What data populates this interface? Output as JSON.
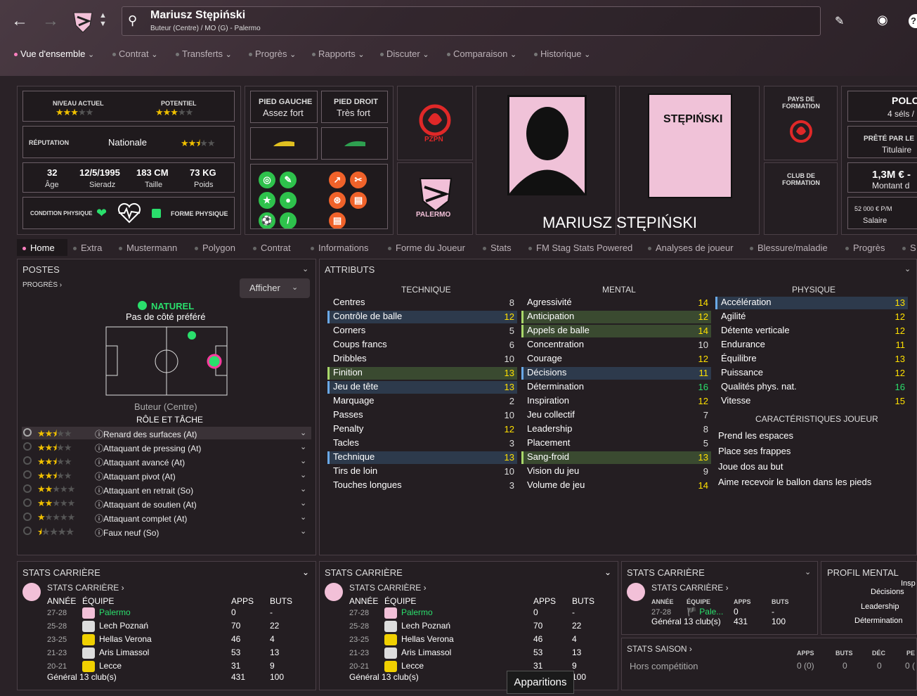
{
  "header": {
    "name": "Mariusz Stępiński",
    "subtitle": "Buteur (Centre) / MO (G) - Palermo"
  },
  "menu": [
    {
      "label": "Vue d'ensemble"
    },
    {
      "label": "Contrat"
    },
    {
      "label": "Transferts"
    },
    {
      "label": "Progrès"
    },
    {
      "label": "Rapports"
    },
    {
      "label": "Discuter"
    },
    {
      "label": "Comparaison"
    },
    {
      "label": "Historique"
    }
  ],
  "info": {
    "niveau_label": "NIVEAU ACTUEL",
    "potentiel_label": "POTENTIEL",
    "niveau_stars": 3,
    "potentiel_stars": 3,
    "reputation_label": "RÉPUTATION",
    "reputation_value": "Nationale",
    "reputation_stars": 2.5,
    "age": "32",
    "age_label": "Âge",
    "dob": "12/5/1995",
    "birthplace": "Sieradz",
    "height": "183 CM",
    "height_label": "Taille",
    "weight": "73 KG",
    "weight_label": "Poids",
    "condition_label": "CONDITION PHYSIQUE",
    "forme_label": "FORME PHYSIQUE"
  },
  "feet": {
    "left_label": "PIED GAUCHE",
    "left_value": "Assez fort",
    "right_label": "PIED DROIT",
    "right_value": "Très fort"
  },
  "badges": {
    "pzpn": "PZPN",
    "palermo": "PALERMO"
  },
  "player": {
    "full_name": "MARIUSZ STĘPIŃSKI",
    "shirt_name": "STĘPIŃSKI"
  },
  "formation": {
    "pays_label": "PAYS DE FORMATION",
    "club_label": "CLUB DE FORMATION"
  },
  "right_cards": {
    "pologne": "POLO",
    "sels": "4 séls /",
    "prete_label": "PRÊTÉ PAR LE",
    "titulaire": "Titulaire",
    "montant": "1,3M € -",
    "montant_label": "Montant d",
    "salaire": "52 000 € P/M",
    "salaire_label": "Salaire"
  },
  "tabs": [
    {
      "label": "Home"
    },
    {
      "label": "Extra"
    },
    {
      "label": "Mustermann"
    },
    {
      "label": "Polygon"
    },
    {
      "label": "Contrat"
    },
    {
      "label": "Informations"
    },
    {
      "label": "Forme du Joueur"
    },
    {
      "label": "Stats"
    },
    {
      "label": "FM Stag Stats Powered"
    },
    {
      "label": "Analyses de joueur"
    },
    {
      "label": "Blessure/maladie"
    },
    {
      "label": "Progrès"
    },
    {
      "label": "S"
    }
  ],
  "postes": {
    "title": "POSTES",
    "progres": "PROGRÈS",
    "afficher": "Afficher",
    "naturel": "NATUREL",
    "cote": "Pas de côté préféré",
    "position": "Buteur (Centre)",
    "role_title": "RÔLE ET TÂCHE",
    "roles": [
      {
        "label": "Renard des surfaces (At)",
        "stars": 2.5
      },
      {
        "label": "Attaquant de pressing (At)",
        "stars": 2.5
      },
      {
        "label": "Attaquant avancé (At)",
        "stars": 2.5
      },
      {
        "label": "Attaquant pivot (At)",
        "stars": 2.5
      },
      {
        "label": "Attaquant en retrait (So)",
        "stars": 2
      },
      {
        "label": "Attaquant de soutien (At)",
        "stars": 2
      },
      {
        "label": "Attaquant complet (At)",
        "stars": 1
      },
      {
        "label": "Faux neuf (So)",
        "stars": 0.5
      }
    ]
  },
  "attributes": {
    "title": "ATTRIBUTS",
    "technique_title": "TECHNIQUE",
    "mental_title": "MENTAL",
    "physique_title": "PHYSIQUE",
    "technique": [
      {
        "name": "Centres",
        "v": "8",
        "c": "w",
        "h": ""
      },
      {
        "name": "Contrôle de balle",
        "v": "12",
        "c": "y",
        "h": "blue"
      },
      {
        "name": "Corners",
        "v": "5",
        "c": "w",
        "h": ""
      },
      {
        "name": "Coups francs",
        "v": "6",
        "c": "w",
        "h": ""
      },
      {
        "name": "Dribbles",
        "v": "10",
        "c": "w",
        "h": ""
      },
      {
        "name": "Finition",
        "v": "13",
        "c": "y",
        "h": "green"
      },
      {
        "name": "Jeu de tête",
        "v": "13",
        "c": "y",
        "h": "blue"
      },
      {
        "name": "Marquage",
        "v": "2",
        "c": "w",
        "h": ""
      },
      {
        "name": "Passes",
        "v": "10",
        "c": "w",
        "h": ""
      },
      {
        "name": "Penalty",
        "v": "12",
        "c": "y",
        "h": ""
      },
      {
        "name": "Tacles",
        "v": "3",
        "c": "w",
        "h": ""
      },
      {
        "name": "Technique",
        "v": "13",
        "c": "y",
        "h": "blue"
      },
      {
        "name": "Tirs de loin",
        "v": "10",
        "c": "w",
        "h": ""
      },
      {
        "name": "Touches longues",
        "v": "3",
        "c": "w",
        "h": ""
      }
    ],
    "mental": [
      {
        "name": "Agressivité",
        "v": "14",
        "c": "y",
        "h": ""
      },
      {
        "name": "Anticipation",
        "v": "12",
        "c": "y",
        "h": "green"
      },
      {
        "name": "Appels de balle",
        "v": "14",
        "c": "y",
        "h": "green"
      },
      {
        "name": "Concentration",
        "v": "10",
        "c": "w",
        "h": ""
      },
      {
        "name": "Courage",
        "v": "12",
        "c": "y",
        "h": ""
      },
      {
        "name": "Décisions",
        "v": "11",
        "c": "y",
        "h": "blue"
      },
      {
        "name": "Détermination",
        "v": "16",
        "c": "g",
        "h": ""
      },
      {
        "name": "Inspiration",
        "v": "12",
        "c": "y",
        "h": ""
      },
      {
        "name": "Jeu collectif",
        "v": "7",
        "c": "w",
        "h": ""
      },
      {
        "name": "Leadership",
        "v": "8",
        "c": "w",
        "h": ""
      },
      {
        "name": "Placement",
        "v": "5",
        "c": "w",
        "h": ""
      },
      {
        "name": "Sang-froid",
        "v": "13",
        "c": "y",
        "h": "green"
      },
      {
        "name": "Vision du jeu",
        "v": "9",
        "c": "w",
        "h": ""
      },
      {
        "name": "Volume de jeu",
        "v": "14",
        "c": "y",
        "h": ""
      }
    ],
    "physique": [
      {
        "name": "Accélération",
        "v": "13",
        "c": "y",
        "h": "blue"
      },
      {
        "name": "Agilité",
        "v": "12",
        "c": "y",
        "h": ""
      },
      {
        "name": "Détente verticale",
        "v": "12",
        "c": "y",
        "h": ""
      },
      {
        "name": "Endurance",
        "v": "11",
        "c": "y",
        "h": ""
      },
      {
        "name": "Équilibre",
        "v": "13",
        "c": "y",
        "h": ""
      },
      {
        "name": "Puissance",
        "v": "12",
        "c": "y",
        "h": ""
      },
      {
        "name": "Qualités phys. nat.",
        "v": "16",
        "c": "g",
        "h": ""
      },
      {
        "name": "Vitesse",
        "v": "15",
        "c": "y",
        "h": ""
      }
    ],
    "traits_title": "CARACTÉRISTIQUES JOUEUR",
    "traits": [
      "Prend les espaces",
      "Place ses frappes",
      "Joue dos au but",
      "Aime recevoir le ballon dans les pieds"
    ]
  },
  "career": {
    "title": "STATS CARRIÈRE",
    "sub": "STATS CARRIÈRE",
    "h_annee": "ANNÉE",
    "h_equipe": "ÉQUIPE",
    "h_apps": "APPS",
    "h_buts": "BUTS",
    "rows": [
      {
        "y": "27-28",
        "team": "Palermo",
        "apps": "0",
        "buts": "-"
      },
      {
        "y": "25-28",
        "team": "Lech Poznań",
        "apps": "70",
        "buts": "22"
      },
      {
        "y": "23-25",
        "team": "Hellas Verona",
        "apps": "46",
        "buts": "4"
      },
      {
        "y": "21-23",
        "team": "Aris Limassol",
        "apps": "53",
        "buts": "13"
      },
      {
        "y": "20-21",
        "team": "Lecce",
        "apps": "31",
        "buts": "9"
      }
    ],
    "total_label": "Général 13 club(s)",
    "total_apps": "431",
    "total_buts": "100",
    "small_team": "Pale...",
    "small_apps": "0",
    "small_buts": "-"
  },
  "mental_profile": {
    "title": "PROFIL MENTAL",
    "labels": [
      "Insp",
      "Décisions",
      "Leadership",
      "Détermination"
    ]
  },
  "season": {
    "title": "STATS SAISON",
    "h_apps": "APPS",
    "h_buts": "BUTS",
    "h_dec": "DÉC",
    "h_pe": "PE",
    "row_label": "Hors compétition",
    "apps": "0 (0)",
    "buts": "0",
    "dec": "0",
    "pe": "0 ("
  },
  "tooltip": "Apparitions"
}
